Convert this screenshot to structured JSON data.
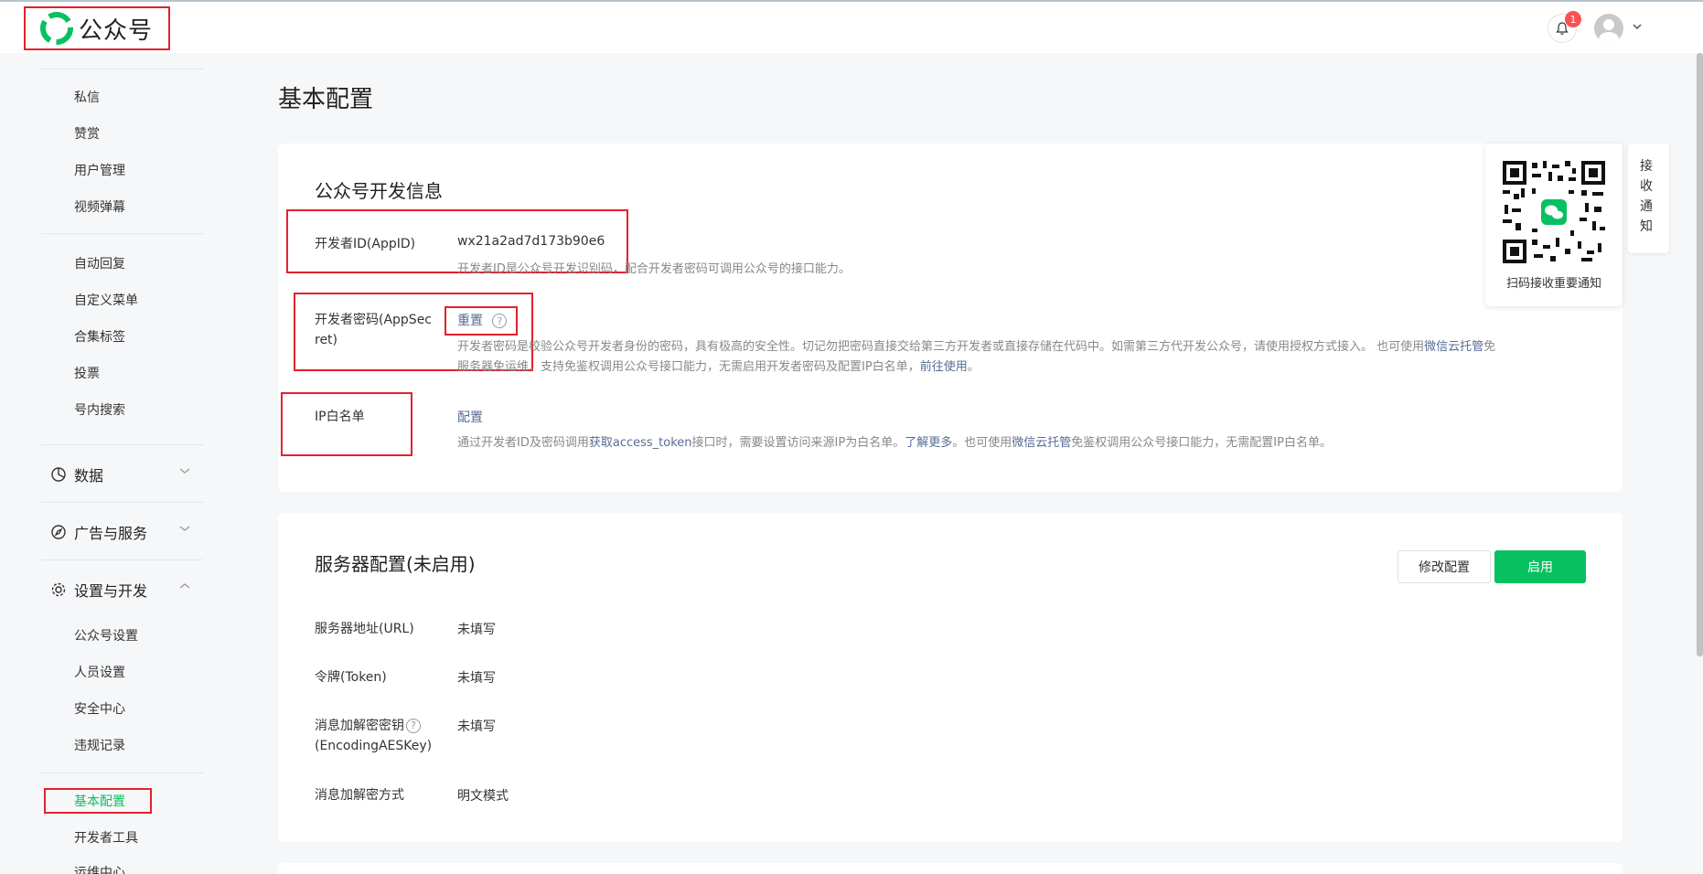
{
  "header": {
    "logo_text": "公众号",
    "notification_count": "1",
    "brand_color": "#07c160"
  },
  "sidebar": {
    "items_top": [
      "私信",
      "赞赏",
      "用户管理",
      "视频弹幕"
    ],
    "items_mid": [
      "自动回复",
      "自定义菜单",
      "合集标签",
      "投票",
      "号内搜索"
    ],
    "groups": {
      "data": "数据",
      "ads": "广告与服务",
      "settings": "设置与开发"
    },
    "settings_items": [
      "公众号设置",
      "人员设置",
      "安全中心",
      "违规记录"
    ],
    "active_item": "基本配置",
    "items_bottom": [
      "开发者工具",
      "运维中心"
    ]
  },
  "page": {
    "title": "基本配置"
  },
  "dev_info": {
    "title": "公众号开发信息",
    "appid_label": "开发者ID(AppID)",
    "appid_value": "wx21a2ad7d173b90e6",
    "appid_desc": "开发者ID是公众号开发识别码，配合开发者密码可调用公众号的接口能力。",
    "secret_label_1": "开发者密码(AppSec",
    "secret_label_2": "ret)",
    "secret_action": "重置",
    "secret_desc_1a": "开发者密码是校验公众号开发者身份的密码，具有极高的安全性。切记勿把密码直接交给第三方开发者或直接存储在代码中。如需第三方代开发公众号，请使用授权方式接入。 也可使用",
    "secret_desc_1_link": "微信云托管",
    "secret_desc_1b": "免",
    "secret_desc_2a": "服务器免运维，支持免鉴权调用公众号接口能力，无需启用开发者密码及配置IP白名单，",
    "secret_desc_2_link": "前往使用",
    "secret_desc_2b": "。",
    "ip_label": "IP白名单",
    "ip_action": "配置",
    "ip_desc_a": "通过开发者ID及密码调用",
    "ip_desc_link1": "获取access_token",
    "ip_desc_b": "接口时，需要设置访问来源IP为白名单。",
    "ip_desc_link2": "了解更多",
    "ip_desc_c": "。也可使用",
    "ip_desc_link3": "微信云托管",
    "ip_desc_d": "免鉴权调用公众号接口能力，无需配置IP白名单。"
  },
  "server_config": {
    "title": "服务器配置(未启用)",
    "modify_label": "修改配置",
    "enable_label": "启用",
    "rows": [
      {
        "label": "服务器地址(URL)",
        "value": "未填写"
      },
      {
        "label": "令牌(Token)",
        "value": "未填写"
      },
      {
        "label": "消息加解密密钥",
        "label2": "(EncodingAESKey)",
        "value": "未填写"
      },
      {
        "label": "消息加解密方式",
        "value": "明文模式"
      }
    ]
  },
  "qr_panel": {
    "caption": "扫码接收重要通知",
    "tab_text": "接收通知"
  }
}
